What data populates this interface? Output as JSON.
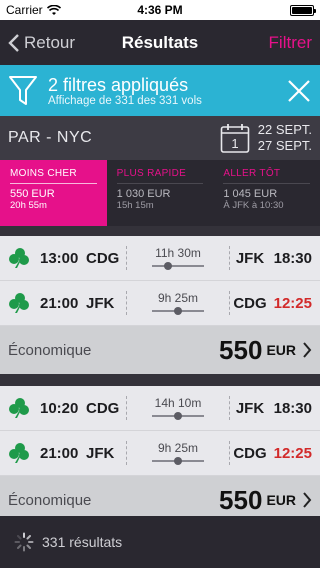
{
  "status_bar": {
    "carrier": "Carrier",
    "time": "4:36 PM",
    "battery_level": 1.0
  },
  "nav": {
    "back_label": "Retour",
    "title": "Résultats",
    "filter_label": "Filtrer"
  },
  "filter_banner": {
    "title": "2 filtres appliqués",
    "subtitle": "Affichage de 331 des 331 vols"
  },
  "route": {
    "text": "PAR - NYC",
    "calendar_day": "1",
    "date_out": "22 SEPT.",
    "date_back": "27 SEPT."
  },
  "sort_tabs": [
    {
      "label": "MOINS CHER",
      "price": "550 EUR",
      "sub": "20h 55m",
      "active": true
    },
    {
      "label": "PLUS RAPIDE",
      "price": "1 030 EUR",
      "sub": "15h 15m",
      "active": false
    },
    {
      "label": "ALLER TÔT",
      "price": "1 045 EUR",
      "sub": "À JFK à 10:30",
      "active": false
    }
  ],
  "results": [
    {
      "legs": [
        {
          "dep_time": "13:00",
          "dep_code": "CDG",
          "duration": "11h 30m",
          "arr_code": "JFK",
          "arr_time": "18:30",
          "late": false,
          "stop_position": 0.3
        },
        {
          "dep_time": "21:00",
          "dep_code": "JFK",
          "duration": "9h 25m",
          "arr_code": "CDG",
          "arr_time": "12:25",
          "late": true,
          "stop_position": 0.5
        }
      ],
      "fare_class": "Économique",
      "price": "550",
      "currency": "EUR"
    },
    {
      "legs": [
        {
          "dep_time": "10:20",
          "dep_code": "CDG",
          "duration": "14h 10m",
          "arr_code": "JFK",
          "arr_time": "18:30",
          "late": false,
          "stop_position": 0.5
        },
        {
          "dep_time": "21:00",
          "dep_code": "JFK",
          "duration": "9h 25m",
          "arr_code": "CDG",
          "arr_time": "12:25",
          "late": true,
          "stop_position": 0.5
        }
      ],
      "fare_class": "Économique",
      "price": "550",
      "currency": "EUR"
    }
  ],
  "footer": {
    "count_text": "331 résultats"
  },
  "colors": {
    "accent": "#e6118a",
    "banner": "#2bb3d3",
    "late": "#d22a2a",
    "airline_green": "#1f9a4a"
  }
}
